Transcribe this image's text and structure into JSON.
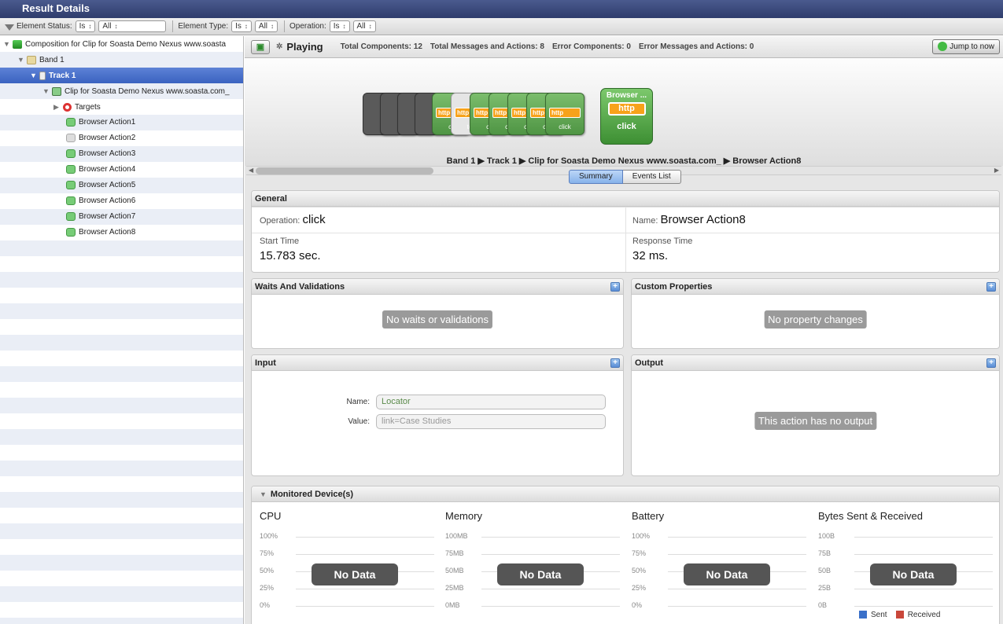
{
  "window_title": "Result Details",
  "filters": {
    "element_status_label": "Element Status:",
    "element_status_op": "Is",
    "element_status_value": "All",
    "element_type_label": "Element Type:",
    "element_type_op": "Is",
    "element_type_value": "All",
    "operation_label": "Operation:",
    "operation_op": "Is",
    "operation_value": "All"
  },
  "tree": {
    "composition": "Composition for Clip for Soasta Demo Nexus www.soasta",
    "band": "Band 1",
    "track": "Track 1",
    "clip": "Clip for Soasta Demo Nexus www.soasta.com_",
    "targets": "Targets",
    "actions": [
      "Browser Action1",
      "Browser Action2",
      "Browser Action3",
      "Browser Action4",
      "Browser Action5",
      "Browser Action6",
      "Browser Action7",
      "Browser Action8"
    ]
  },
  "status": {
    "state": "Playing",
    "total_components": "Total Components: 12",
    "total_messages": "Total Messages and Actions: 8",
    "error_components": "Error Components: 0",
    "error_messages": "Error Messages and Actions: 0",
    "jump_label": "Jump to now"
  },
  "stage": {
    "cards": [
      {
        "label": "",
        "http": false,
        "style": "dark"
      },
      {
        "label": "",
        "http": false,
        "style": "dark"
      },
      {
        "label": "",
        "http": false,
        "style": "dark"
      },
      {
        "label": "",
        "http": false,
        "style": "dark"
      },
      {
        "label": "cl",
        "http": true,
        "style": "g"
      },
      {
        "label": "to",
        "http": true,
        "style": "w"
      },
      {
        "label": "cl",
        "http": true,
        "style": "g"
      },
      {
        "label": "cl",
        "http": true,
        "style": "g"
      },
      {
        "label": "cl",
        "http": true,
        "style": "g"
      },
      {
        "label": "cl",
        "http": true,
        "style": "g"
      },
      {
        "label": "click",
        "http": true,
        "style": "g"
      }
    ],
    "http_text": "http",
    "current_title": "Browser ...",
    "current_http": "http",
    "current_op": "click"
  },
  "breadcrumb": "Band 1  ▶  Track 1  ▶  Clip for Soasta Demo Nexus www.soasta.com_  ▶  Browser Action8",
  "tabs": {
    "summary": "Summary",
    "events": "Events List"
  },
  "general": {
    "title": "General",
    "operation_label": "Operation:",
    "operation_value": "click",
    "name_label": "Name:",
    "name_value": "Browser Action8",
    "start_label": "Start Time",
    "start_value": "15.783 sec.",
    "response_label": "Response Time",
    "response_value": "32 ms."
  },
  "waits": {
    "title": "Waits And Validations",
    "empty": "No waits or validations"
  },
  "custom": {
    "title": "Custom Properties",
    "empty": "No property changes"
  },
  "input": {
    "title": "Input",
    "name_label": "Name:",
    "name_value": "Locator",
    "value_label": "Value:",
    "value_value": "link=Case Studies"
  },
  "output": {
    "title": "Output",
    "empty": "This action has no output"
  },
  "monitored": {
    "title": "Monitored Device(s)",
    "no_data": "No Data",
    "graphs": [
      {
        "title": "CPU",
        "ticks": [
          "100%",
          "75%",
          "50%",
          "25%",
          "0%"
        ]
      },
      {
        "title": "Memory",
        "ticks": [
          "100MB",
          "75MB",
          "50MB",
          "25MB",
          "0MB"
        ]
      },
      {
        "title": "Battery",
        "ticks": [
          "100%",
          "75%",
          "50%",
          "25%",
          "0%"
        ]
      },
      {
        "title": "Bytes Sent & Received",
        "ticks": [
          "100B",
          "75B",
          "50B",
          "25B",
          "0B"
        ]
      }
    ],
    "legend": {
      "sent": "Sent",
      "received": "Received",
      "sent_color": "#3a70c9",
      "received_color": "#c9473a"
    }
  }
}
